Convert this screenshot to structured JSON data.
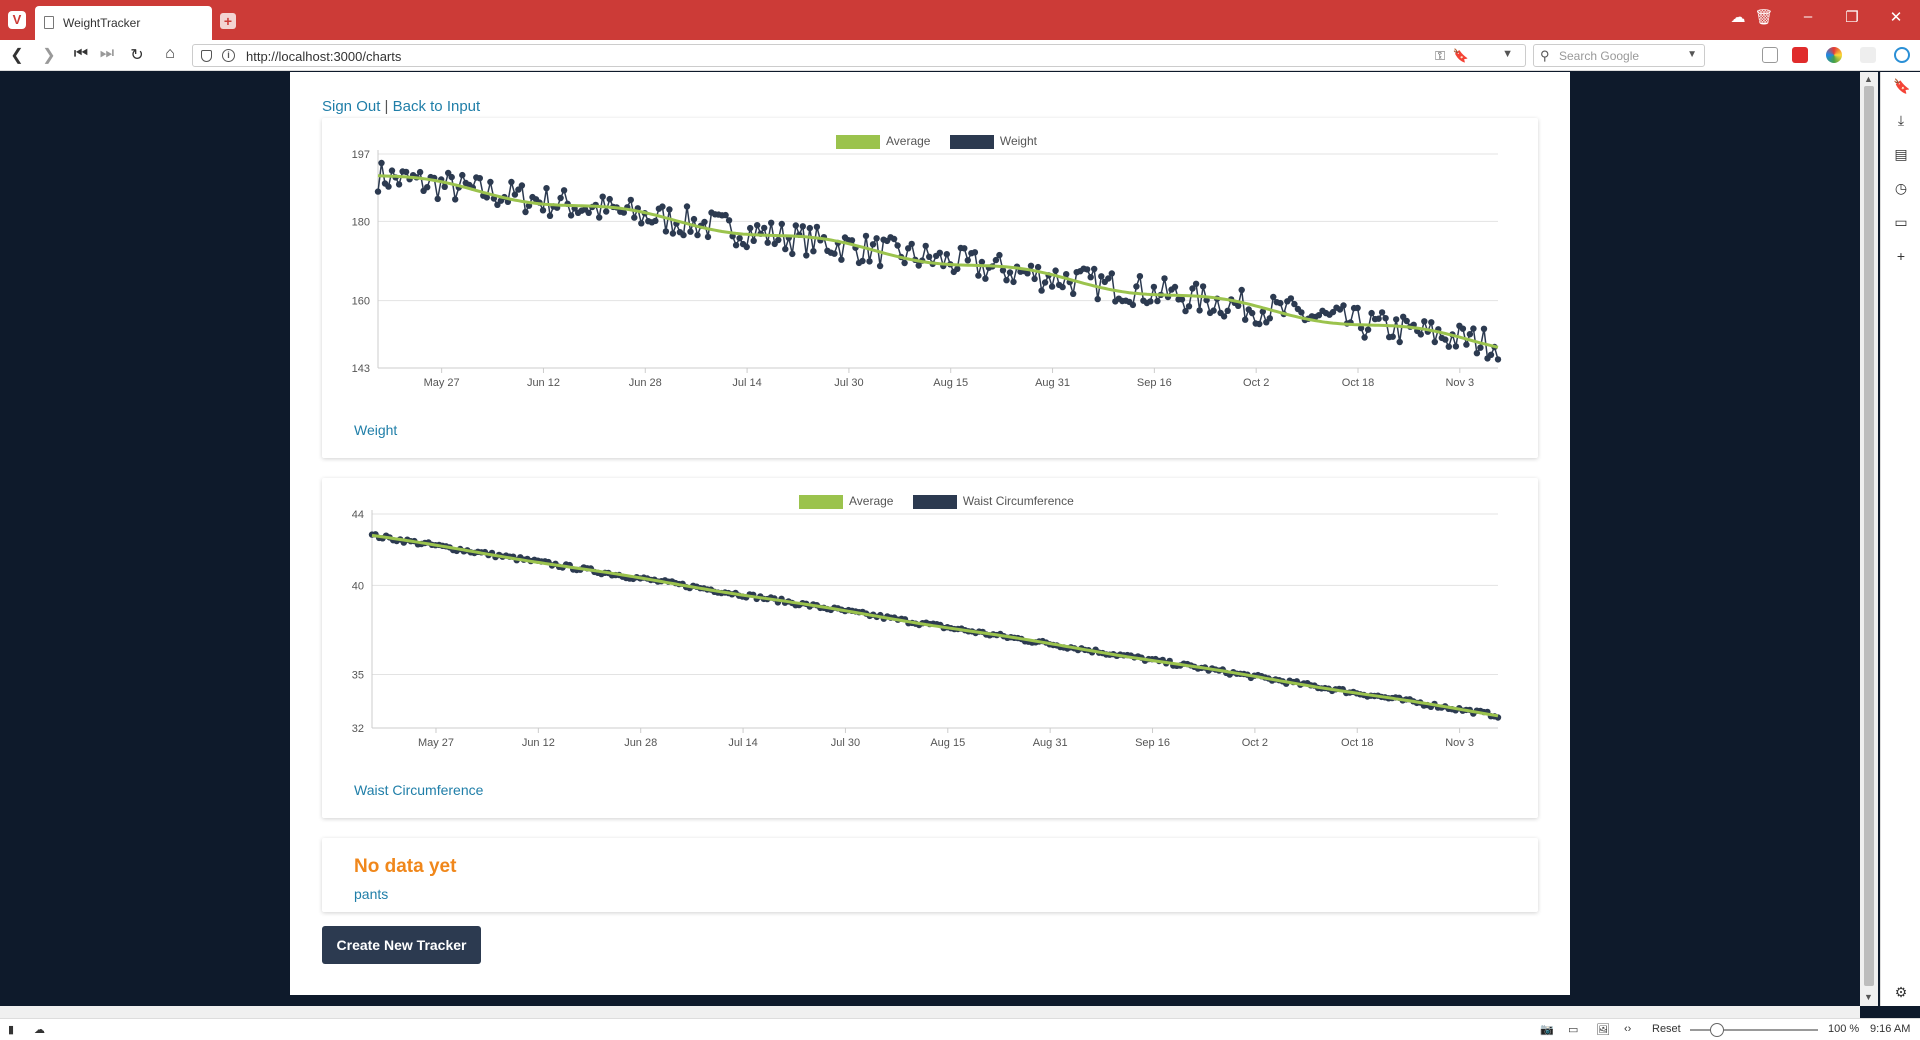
{
  "browser": {
    "tab_title": "WeightTracker",
    "url": "http://localhost:3000/charts",
    "search_placeholder": "Search Google",
    "zoom_reset": "Reset",
    "zoom_level": "100 %",
    "clock": "9:16 AM"
  },
  "page": {
    "sign_out": "Sign Out",
    "separator": "|",
    "back_to_input": "Back to Input",
    "no_data_title": "No data yet",
    "no_data_tracker": "pants",
    "create_button": "Create New Tracker"
  },
  "colors": {
    "average": "#9bc34d",
    "series": "#2c3a50",
    "link": "#1f7ea8",
    "nodata": "#f0871b"
  },
  "chart_data": [
    {
      "type": "line",
      "label": "Weight",
      "series": [
        {
          "name": "Average",
          "trend": {
            "start": 191.5,
            "end": 149.0
          }
        },
        {
          "name": "Weight",
          "scatter_around_average": 4.0
        }
      ],
      "ylim": [
        143,
        197
      ],
      "yticks": [
        143,
        160,
        180,
        197
      ],
      "xrange": [
        "May 17",
        "Nov 9"
      ],
      "xtick_labels": [
        "May 27",
        "Jun 12",
        "Jun 28",
        "Jul 14",
        "Jul 30",
        "Aug 15",
        "Aug 31",
        "Sep 16",
        "Oct 2",
        "Oct 18",
        "Nov 3"
      ],
      "grid": true,
      "legend": "top-center"
    },
    {
      "type": "line",
      "label": "Waist Circumference",
      "series": [
        {
          "name": "Average",
          "trend": {
            "start": 42.8,
            "end": 32.7
          }
        },
        {
          "name": "Waist Circumference",
          "scatter_around_average": 0.12
        }
      ],
      "ylim": [
        32,
        44
      ],
      "yticks": [
        32,
        35,
        40,
        44
      ],
      "xrange": [
        "May 17",
        "Nov 9"
      ],
      "xtick_labels": [
        "May 27",
        "Jun 12",
        "Jun 28",
        "Jul 14",
        "Jul 30",
        "Aug 15",
        "Aug 31",
        "Sep 16",
        "Oct 2",
        "Oct 18",
        "Nov 3"
      ],
      "grid": true,
      "legend": "top-center"
    }
  ]
}
